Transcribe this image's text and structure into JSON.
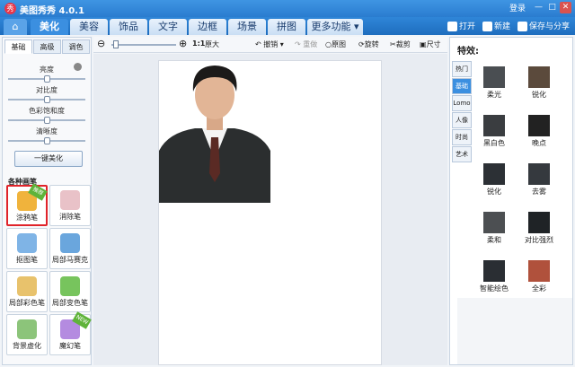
{
  "app": {
    "title": "美图秀秀 4.0.1",
    "logo_char": "秀"
  },
  "window": {
    "login": "登录",
    "min": "—",
    "max": "□",
    "close": "✕"
  },
  "nav": {
    "home_icon": "house-icon",
    "tabs": [
      "美化",
      "美容",
      "饰品",
      "文字",
      "边框",
      "场景",
      "拼图",
      "更多功能 ▾"
    ],
    "active_tab": "美化",
    "actions": [
      "打开",
      "新建",
      "保存与分享"
    ]
  },
  "left": {
    "subtabs": [
      "基础",
      "高级",
      "调色"
    ],
    "adjustments": [
      {
        "label": "亮度",
        "level": 0.5
      },
      {
        "label": "对比度",
        "level": 0.5
      },
      {
        "label": "色彩饱和度",
        "level": 0.5
      },
      {
        "label": "清晰度",
        "level": 0.5
      }
    ],
    "onekey": "一键美化",
    "brushes_title": "各种画笔",
    "tools": [
      {
        "label": "涂鸦笔",
        "color": "#f0b33c",
        "badge": "推荐"
      },
      {
        "label": "消除笔",
        "color": "#e9c2c8"
      },
      {
        "label": "抠图笔",
        "color": "#7fb4e6"
      },
      {
        "label": "局部马赛克",
        "color": "#6aa6dd"
      },
      {
        "label": "局部彩色笔",
        "color": "#e8c26c"
      },
      {
        "label": "局部变色笔",
        "color": "#77c45d"
      },
      {
        "label": "背景虚化",
        "color": "#8cc47a"
      },
      {
        "label": "魔幻笔",
        "color": "#b48be0",
        "badge": "NEW"
      }
    ]
  },
  "toolbar": {
    "zoom_out": "⊖",
    "zoom_in": "⊕",
    "actual": "1:1",
    "actual_label": "原大",
    "undo": "撤销",
    "redo": "重做",
    "original": "原图",
    "rotate": "旋转",
    "crop": "裁剪",
    "size": "尺寸"
  },
  "right": {
    "title": "特效:",
    "categories": [
      "热门",
      "基础",
      "Lomo",
      "人像",
      "时尚",
      "艺术"
    ],
    "active_category": "基础",
    "effects": [
      "柔光",
      "锐化",
      "黑白色",
      "晚点",
      "锐化",
      "去雾",
      "柔和",
      "对比强烈",
      "智能绘色",
      "全彩"
    ]
  }
}
